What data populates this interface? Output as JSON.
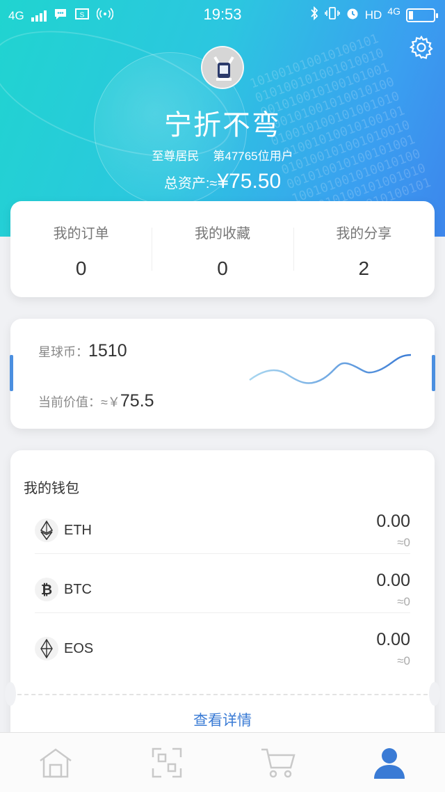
{
  "status_bar": {
    "network": "4G",
    "time": "19:53",
    "hd": "HD",
    "network_right": "4G",
    "sim_icon": "S"
  },
  "profile": {
    "username": "宁折不弯",
    "level": "至尊居民",
    "rank_text": "第47765位用户",
    "assets_label": "总资产:≈",
    "assets_value": "¥75.50"
  },
  "stats": [
    {
      "label": "我的订单",
      "value": "0"
    },
    {
      "label": "我的收藏",
      "value": "0"
    },
    {
      "label": "我的分享",
      "value": "2"
    }
  ],
  "coin": {
    "balance_label": "星球币：",
    "balance_value": "1510",
    "worth_label": "当前价值：≈￥",
    "worth_value": "75.5"
  },
  "wallet": {
    "title": "我的钱包",
    "items": [
      {
        "symbol": "ETH",
        "balance": "0.00",
        "approx": "≈0",
        "icon": "ethereum-icon"
      },
      {
        "symbol": "BTC",
        "balance": "0.00",
        "approx": "≈0",
        "icon": "bitcoin-icon"
      },
      {
        "symbol": "EOS",
        "balance": "0.00",
        "approx": "≈0",
        "icon": "eos-icon"
      }
    ],
    "detail_link": "查看详情"
  },
  "tabbar": {
    "tabs": [
      "home-icon",
      "scan-icon",
      "cart-icon",
      "profile-icon"
    ],
    "active_color": "#3a7bd5"
  },
  "colors": {
    "header_start": "#20d4d0",
    "header_end": "#3d86ec",
    "accent": "#3a7bd5"
  }
}
